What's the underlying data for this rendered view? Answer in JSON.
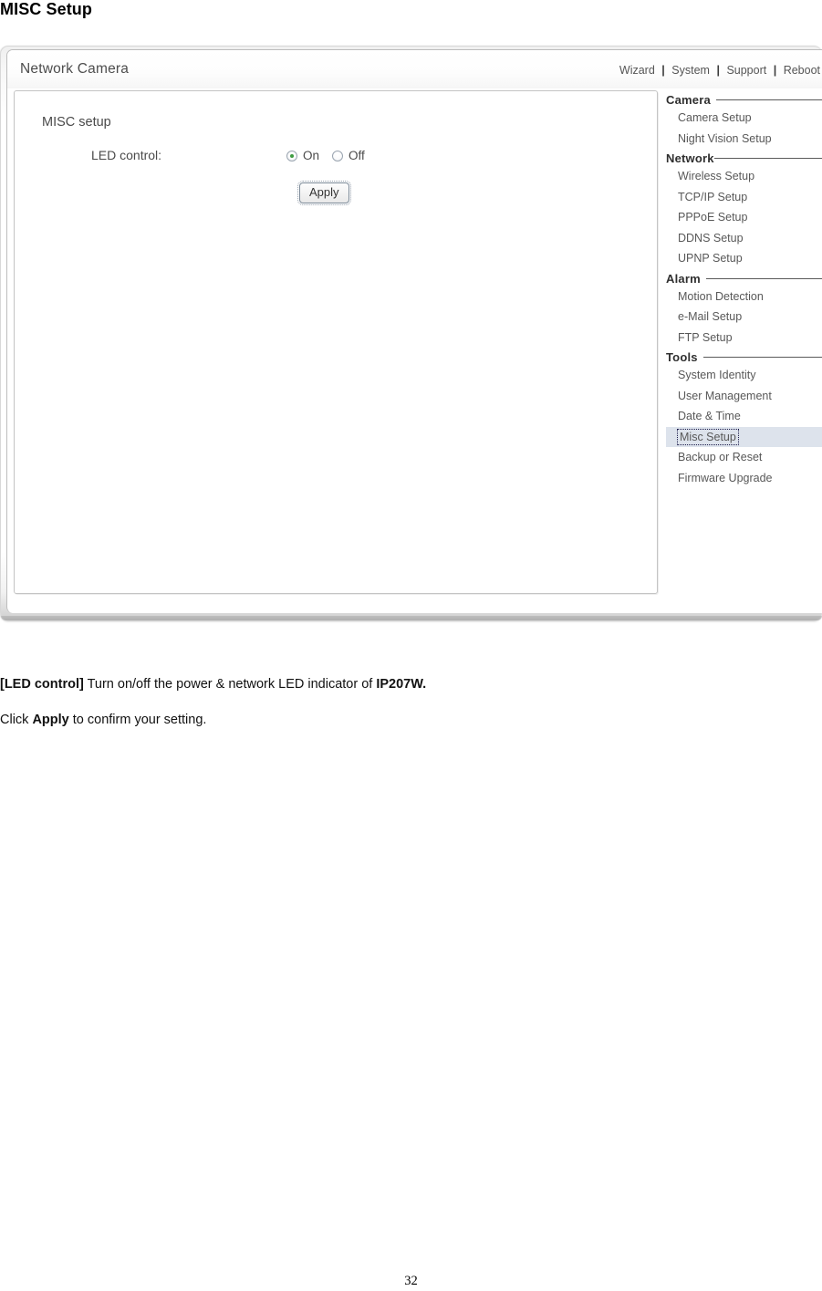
{
  "document": {
    "title": "MISC Setup",
    "page_number": "32"
  },
  "screenshot": {
    "header": {
      "brand": "Network Camera",
      "nav": [
        {
          "label": "Wizard"
        },
        {
          "label": "System"
        },
        {
          "label": "Support"
        },
        {
          "label": "Reboot"
        }
      ],
      "nav_separator": "|"
    },
    "content": {
      "heading": "MISC setup",
      "led_control": {
        "label": "LED control:",
        "options": [
          {
            "label": "On",
            "selected": true
          },
          {
            "label": "Off",
            "selected": false
          }
        ],
        "selected_value": "On"
      },
      "apply_button": "Apply"
    },
    "sidebar": {
      "groups": [
        {
          "title": "Camera",
          "items": [
            {
              "label": "Camera Setup",
              "selected": false
            },
            {
              "label": "Night Vision Setup",
              "selected": false
            }
          ]
        },
        {
          "title": "Network",
          "items": [
            {
              "label": "Wireless Setup",
              "selected": false
            },
            {
              "label": "TCP/IP Setup",
              "selected": false
            },
            {
              "label": "PPPoE Setup",
              "selected": false
            },
            {
              "label": "DDNS Setup",
              "selected": false
            },
            {
              "label": "UPNP Setup",
              "selected": false
            }
          ]
        },
        {
          "title": "Alarm",
          "items": [
            {
              "label": "Motion Detection",
              "selected": false
            },
            {
              "label": "e-Mail Setup",
              "selected": false
            },
            {
              "label": "FTP Setup",
              "selected": false
            }
          ]
        },
        {
          "title": "Tools",
          "items": [
            {
              "label": "System Identity",
              "selected": false
            },
            {
              "label": "User Management",
              "selected": false
            },
            {
              "label": "Date & Time",
              "selected": false
            },
            {
              "label": "Misc Setup",
              "selected": true
            },
            {
              "label": "Backup or Reset",
              "selected": false
            },
            {
              "label": "Firmware Upgrade",
              "selected": false
            }
          ]
        }
      ]
    }
  },
  "body_text": {
    "paragraph1": {
      "bold_lead": "[LED control]",
      "text": " Turn on/off the power & network LED indicator of ",
      "bold_tail": "IP207W."
    },
    "paragraph2": {
      "lead": "Click ",
      "bold": "Apply",
      "tail": " to confirm your setting."
    }
  },
  "colors": {
    "selected_item_bg": "#dde3ec",
    "radio_selected_dot": "#3f9c42",
    "sidebar_text": "#585858",
    "group_title": "#2f2f2f"
  }
}
